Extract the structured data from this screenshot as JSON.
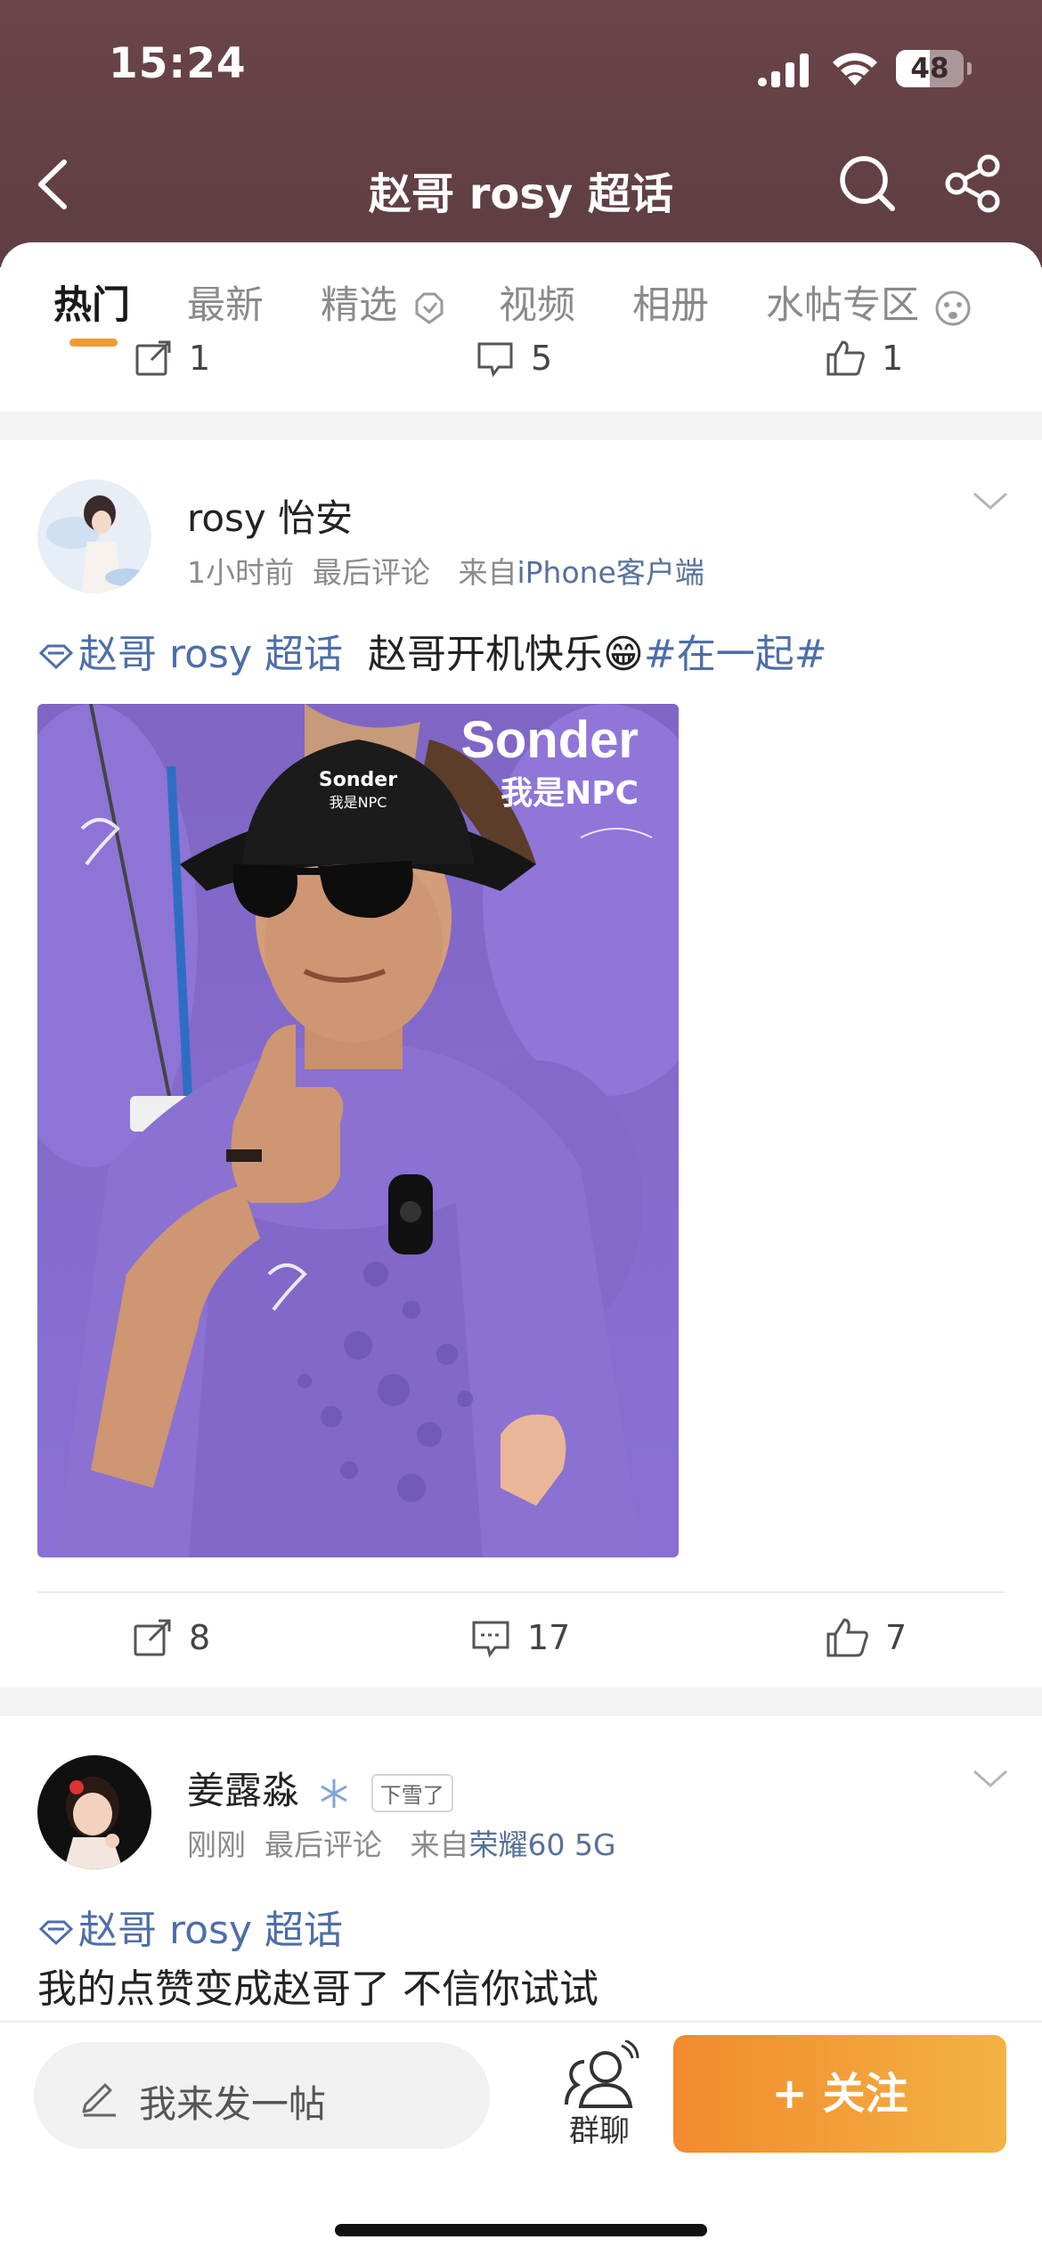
{
  "status_bar": {
    "time": "15:24",
    "battery": "48"
  },
  "nav": {
    "title": "赵哥 rosy 超话"
  },
  "tabs": [
    {
      "label": "热门",
      "active": true
    },
    {
      "label": "最新"
    },
    {
      "label": "精选"
    },
    {
      "label": "视频"
    },
    {
      "label": "相册"
    },
    {
      "label": "水帖专区"
    }
  ],
  "prev_post_actions": {
    "reposts": "1",
    "comments": "5",
    "likes": "1"
  },
  "post1": {
    "user": "rosy 怡安",
    "time": "1小时前",
    "last_comment": "最后评论",
    "source_prefix": "来自",
    "source": "iPhone客户端",
    "topic": "赵哥 rosy 超话",
    "text": "赵哥开机快乐",
    "emoji": "😁",
    "hashtag": "#在一起#",
    "photo": {
      "brand": "Sonder",
      "caption": "我是NPC",
      "hat_text": "Sonder",
      "hat_sub": "我是NPC"
    },
    "actions": {
      "reposts": "8",
      "comments": "17",
      "likes": "7"
    }
  },
  "post2": {
    "user": "姜露淼",
    "badge": "下雪了",
    "time": "刚刚",
    "last_comment": "最后评论",
    "source_prefix": "来自",
    "source": "荣耀60 5G",
    "topic": "赵哥 rosy 超话",
    "text": "我的点赞变成赵哥了 不信你试试"
  },
  "bottom_bar": {
    "compose_placeholder": "我来发一帖",
    "group_label": "群聊",
    "follow_label": "+ 关注"
  },
  "colors": {
    "accent": "#f29a33",
    "link": "#4e6ea8",
    "header": "#6a4448",
    "photo_purple": "#8a6fd0"
  }
}
